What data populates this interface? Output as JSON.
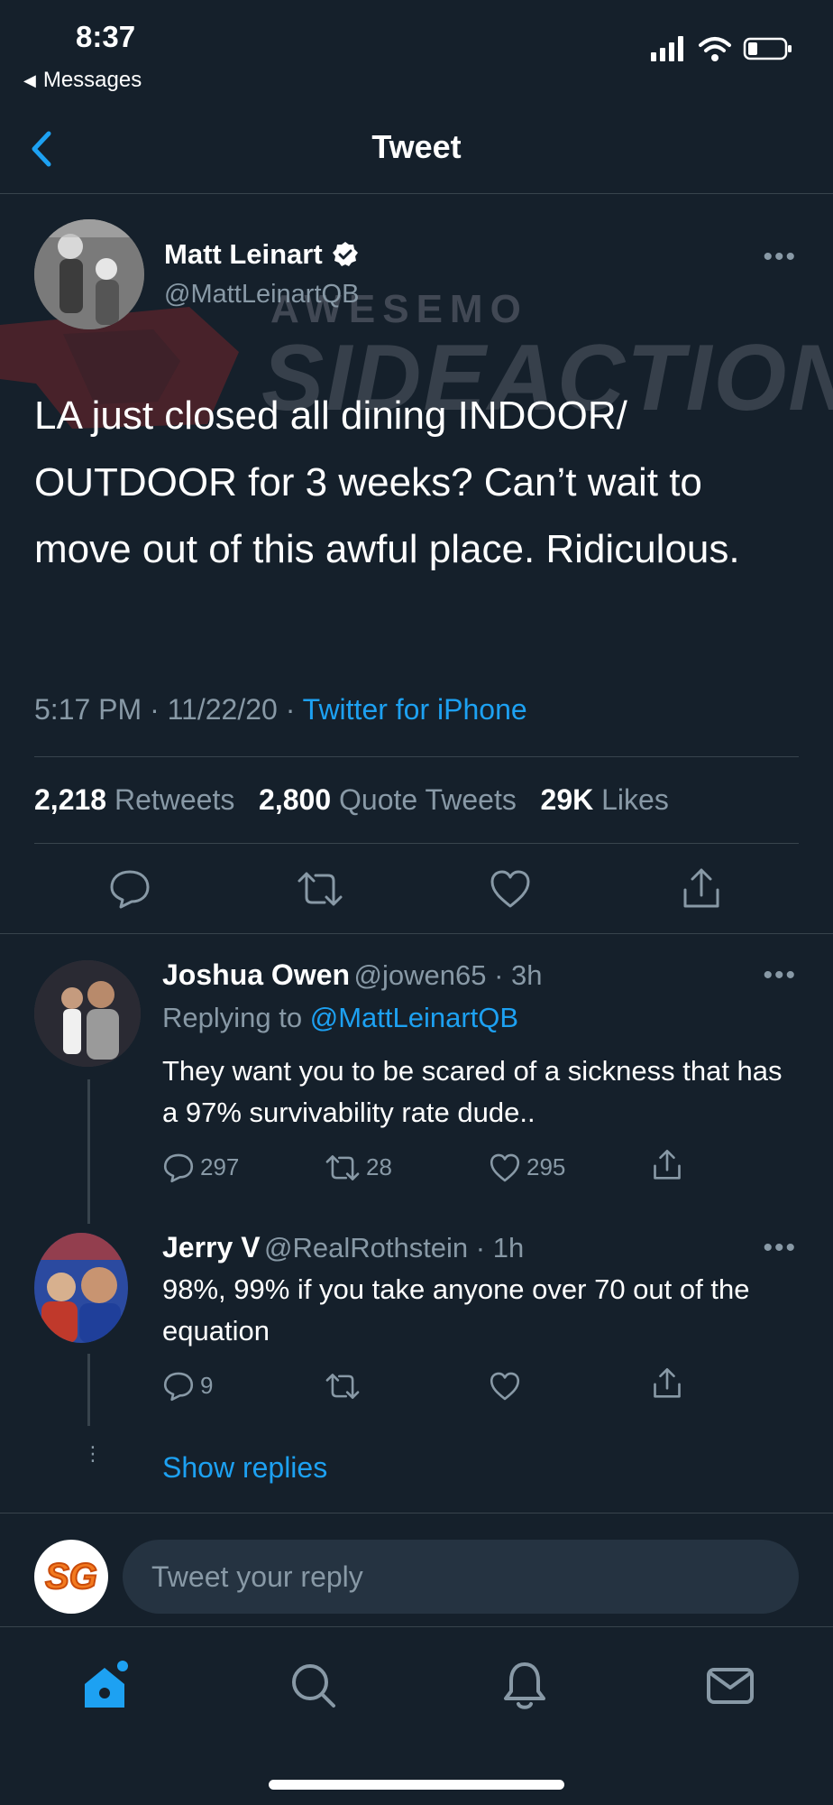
{
  "status_bar": {
    "time": "8:37",
    "back_label": "Messages"
  },
  "header": {
    "title": "Tweet"
  },
  "tweet": {
    "author_name": "Matt Leinart",
    "author_handle": "@MattLeinartQB",
    "verified": true,
    "text": "LA just closed all dining INDOOR/ OUTDOOR for 3 weeks?   Can’t wait to move out of this awful place. Ridiculous.",
    "time": "5:17 PM",
    "date": "11/22/20",
    "source": "Twitter for iPhone",
    "stats": {
      "retweets_count": "2,218",
      "retweets_label": "Retweets",
      "quotes_count": "2,800",
      "quotes_label": "Quote Tweets",
      "likes_count": "29K",
      "likes_label": "Likes"
    }
  },
  "watermark": {
    "line1": "AWESEMO",
    "line2": "SIDEACTION"
  },
  "replies": [
    {
      "name": "Joshua Owen",
      "handle": "@jowen65",
      "age": "3h",
      "replying_prefix": "Replying to",
      "replying_to": "@MattLeinartQB",
      "text": "They want you to be scared of a sickness that has a 97% survivability rate dude..",
      "reply_count": "297",
      "retweet_count": "28",
      "like_count": "295"
    },
    {
      "name": "Jerry V",
      "handle": "@RealRothstein",
      "age": "1h",
      "text": "98%, 99% if you take anyone over 70 out of the equation",
      "reply_count": "9",
      "retweet_count": "",
      "like_count": ""
    }
  ],
  "show_replies_label": "Show replies",
  "composer": {
    "avatar_text": "SG",
    "placeholder": "Tweet your reply"
  },
  "colors": {
    "background": "#15202b",
    "accent": "#1da1f2",
    "muted": "#8899a6",
    "divider": "#38444d"
  },
  "icons": {
    "tabs": [
      "home-icon",
      "search-icon",
      "notifications-icon",
      "messages-icon"
    ]
  }
}
